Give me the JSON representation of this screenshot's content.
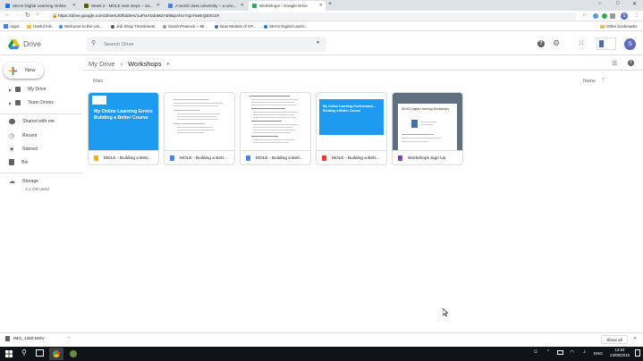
{
  "browser": {
    "tabs": [
      {
        "title": "SEAS Digital Learning Online",
        "color": "#1a73e8"
      },
      {
        "title": "Week 2 - MOLE next steps – Sa...",
        "color": "#5f5f00"
      },
      {
        "title": "A world class university – a unic...",
        "color": "#4285f4"
      },
      {
        "title": "Workshops - Google Drive",
        "color": "#34a853"
      }
    ],
    "new_tab": "+",
    "window_controls": [
      "–",
      "□",
      "✕"
    ],
    "url": "https://drive.google.com/drive/u/0/folders/1uFi4A0dxMZA5hBpAhUYnpY6eEQE0G4F",
    "bookmarks": [
      "Apps",
      "Useful Info",
      "Welcome to the Uni...",
      "Job Shop Timesheets",
      "Sarah Peacock – Mi...",
      "New Models of CP...",
      "SEAS Digital Learni..."
    ],
    "other_bookmarks": "Other bookmarks",
    "avatar_letter": "S"
  },
  "drive": {
    "logo_text": "Drive",
    "search_placeholder": "Search Drive",
    "new_button": "New",
    "avatar_letter": "S",
    "breadcrumb": {
      "root": "My Drive",
      "separator": "›",
      "current": "Workshops",
      "caret": "▾"
    },
    "sidebar": [
      {
        "label": "My Drive",
        "icon": "my-drive-icon"
      },
      {
        "label": "Team Drives",
        "icon": "team-drives-icon"
      },
      {
        "label": "Shared with me",
        "icon": "shared-icon"
      },
      {
        "label": "Recent",
        "icon": "clock-icon"
      },
      {
        "label": "Starred",
        "icon": "star-icon"
      },
      {
        "label": "Bin",
        "icon": "bin-icon"
      },
      {
        "label": "Storage",
        "icon": "cloud-icon"
      }
    ],
    "storage_used": "3.1 GB used",
    "section_label": "Files",
    "sort_label": "Name",
    "files": [
      {
        "name": "MOLE - Building a Bett...",
        "type": "slides",
        "icon_color": "#f4b400",
        "thumb_title": "My Online Learning Enviro Building a Better Course"
      },
      {
        "name": "MOLE - Building a Bett...",
        "type": "docs",
        "icon_color": "#4285f4",
        "thumb_title": ""
      },
      {
        "name": "MOLE - Building a Bett...",
        "type": "docs",
        "icon_color": "#4285f4",
        "thumb_title": ""
      },
      {
        "name": "MOLE - Building a Bett...",
        "type": "pdf",
        "icon_color": "#db4437",
        "thumb_title": "My Online Learning Environment – Building a Better Course"
      },
      {
        "name": "Workshops Sign Up",
        "type": "forms",
        "icon_color": "#7248b9",
        "thumb_title": "SEAS Digital Learning Workshops"
      }
    ]
  },
  "download_bar": {
    "file": "IMG_1460.MOV",
    "show_all": "Show all",
    "close": "✕"
  },
  "taskbar": {
    "lang": "ENG",
    "time": "14:54",
    "date": "23/08/2019"
  }
}
